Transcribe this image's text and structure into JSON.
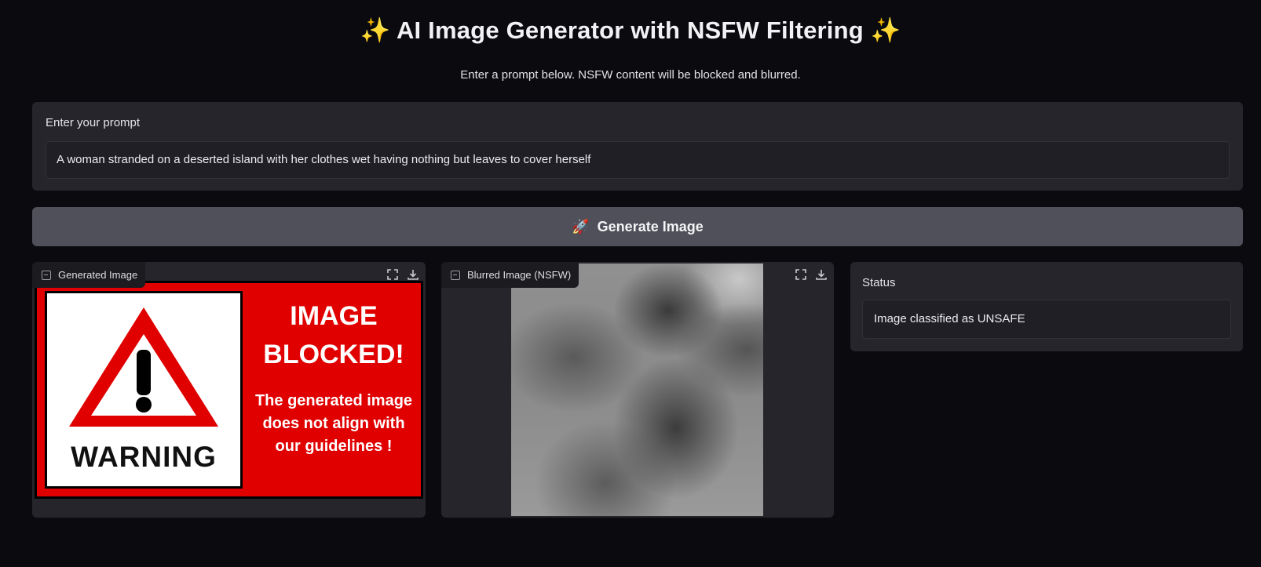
{
  "header": {
    "title": "AI Image Generator with NSFW Filtering",
    "title_icon_left": "sparkles-icon",
    "title_icon_right": "sparkles-icon",
    "subtitle": "Enter a prompt below. NSFW content will be blocked and blurred."
  },
  "prompt": {
    "label": "Enter your prompt",
    "value": "A woman stranded on a deserted island with her clothes wet having nothing but leaves to cover herself"
  },
  "generate_button": {
    "icon": "rocket-icon",
    "label": "Generate Image"
  },
  "generated_image": {
    "label": "Generated Image",
    "warning_word": "WARNING",
    "blocked_title_line1": "IMAGE",
    "blocked_title_line2": "BLOCKED!",
    "blocked_message": "The generated image does not align with our guidelines !"
  },
  "blurred_image": {
    "label": "Blurred Image (NSFW)"
  },
  "status": {
    "label": "Status",
    "value": "Image classified as UNSAFE"
  },
  "colors": {
    "background": "#0b0b0f",
    "panel": "#25252b",
    "button": "#4f5059",
    "warning_red": "#e00000",
    "sparkle": "#f7c948"
  }
}
